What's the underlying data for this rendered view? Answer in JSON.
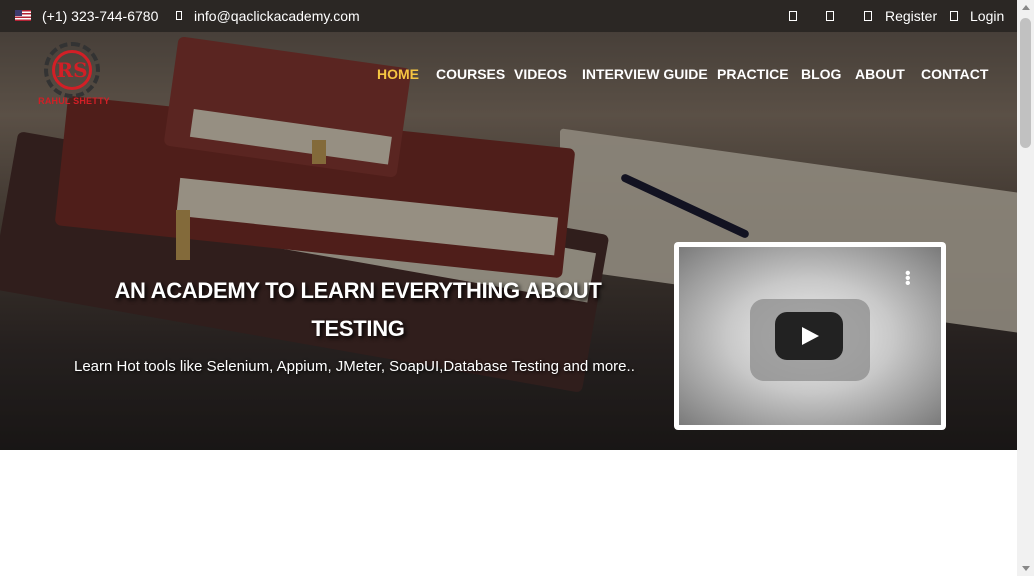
{
  "topbar": {
    "flag_icon": "us-flag-icon",
    "phone": "(+1) 323-744-6780",
    "email": "info@qaclickacademy.com",
    "register": "Register",
    "login": "Login"
  },
  "logo": {
    "mark": "RS",
    "name": "RAHUL SHETTY"
  },
  "nav": {
    "items": [
      "HOME",
      "COURSES",
      "VIDEOS",
      "INTERVIEW GUIDE",
      "PRACTICE",
      "BLOG",
      "ABOUT",
      "CONTACT"
    ],
    "active": "HOME"
  },
  "hero": {
    "headline_line1": "AN ACADEMY TO LEARN EVERYTHING ABOUT",
    "headline_line2": "TESTING",
    "subtitle": "Learn Hot tools like Selenium, Appium, JMeter, SoapUI,Database Testing and more.."
  },
  "video": {
    "play_icon": "play-icon",
    "menu_icon": "more-vertical-icon"
  },
  "colors": {
    "topbar_bg": "#2b2724",
    "nav_active": "#f5c642",
    "brand_red": "#d21f26"
  }
}
